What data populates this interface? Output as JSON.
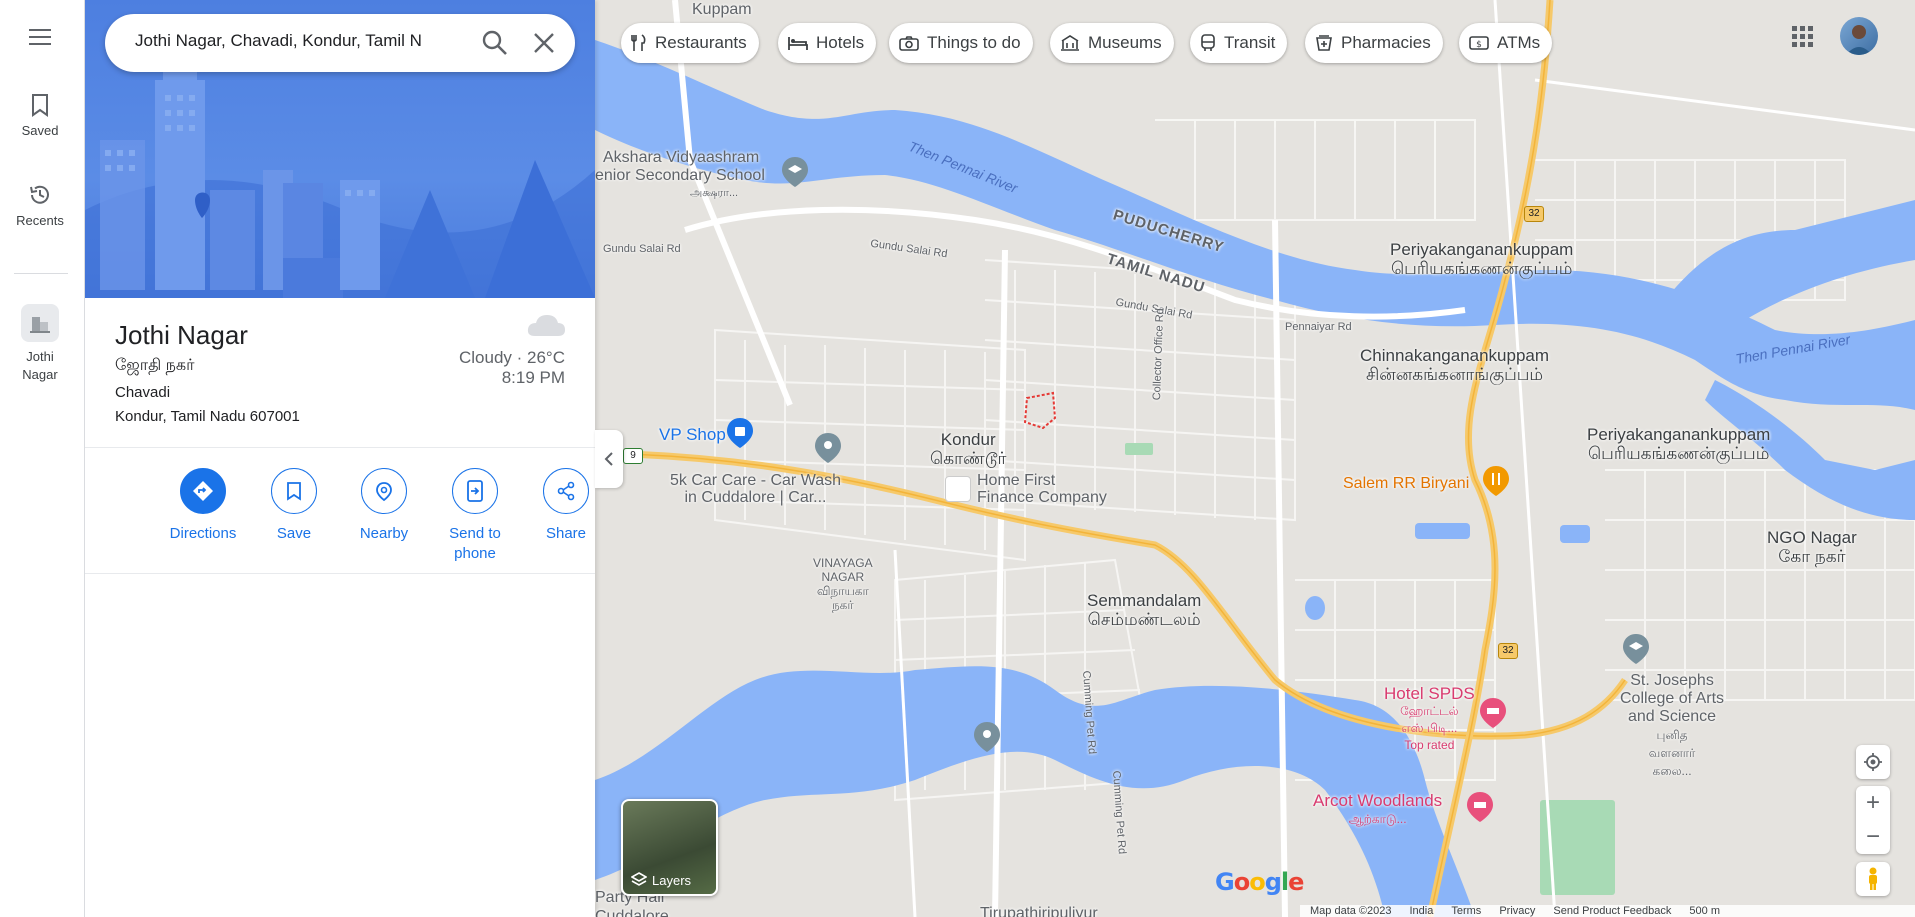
{
  "rail": {
    "menu_label": "",
    "saved_label": "Saved",
    "recents_label": "Recents",
    "place_label": "Jothi Nagar"
  },
  "search": {
    "value": "Jothi Nagar, Chavadi, Kondur, Tamil N"
  },
  "place": {
    "title": "Jothi Nagar",
    "local_name": "ஜோதி நகர்",
    "address_line1": "Chavadi",
    "address_line2": "Kondur, Tamil Nadu 607001",
    "weather": "Cloudy · 26°C",
    "time": "8:19 PM"
  },
  "actions": {
    "directions": "Directions",
    "save": "Save",
    "nearby": "Nearby",
    "send_line1": "Send to",
    "send_line2": "phone",
    "share": "Share"
  },
  "chips": {
    "restaurants": "Restaurants",
    "hotels": "Hotels",
    "things_to_do": "Things to do",
    "museums": "Museums",
    "transit": "Transit",
    "pharmacies": "Pharmacies",
    "atms": "ATMs"
  },
  "map_labels": {
    "kuppam": "Kuppam",
    "akshara": "Akshara Vidyaashram",
    "akshara2": "enior Secondary School",
    "akshara_local": "அக்ஷரா...",
    "then_pennai_1": "Then Pennai River",
    "then_pennai_2": "Then Pennai River",
    "puducherry": "PUDUCHERRY",
    "tamil_nadu": "TAMIL NADU",
    "gundu_salai_1": "Gundu Salai Rd",
    "gundu_salai_2": "Gundu Salai Rd",
    "gundu_salai_3": "Gundu Salai Rd",
    "pennaiyar_rd": "Pennaiyar Rd",
    "periya1_en": "Periyakanganankuppam",
    "periya1_ta": "பெரியகங்கணன்குப்பம்",
    "chinna_en": "Chinnakanganankuppam",
    "chinna_ta": "சின்னகங்கனாங்குப்பம்",
    "periya2_en": "Periyakanganankuppam",
    "periya2_ta": "பெரியகங்கணன்குப்பம்",
    "vp_shop": "VP Shop",
    "kondur_en": "Kondur",
    "kondur_ta": "கொண்டூர்",
    "home_first_1": "Home First",
    "home_first_2": "Finance Company",
    "car_care_1": "5k Car Care - Car Wash",
    "car_care_2": "in Cuddalore | Car...",
    "collector_rd": "Collector Office Rd",
    "salem_rr": "Salem RR Biryani",
    "ngo_en": "NGO Nagar",
    "ngo_ta": "கோ நகர்",
    "vinayaga_1": "VINAYAGA",
    "vinayaga_2": "NAGAR",
    "vinayaga_3": "விநாயகா",
    "vinayaga_4": "நகர்",
    "semm_en": "Semmandalam",
    "semm_ta": "செம்மண்டலம்",
    "hotel_spds": "Hotel SPDS",
    "hotel_spds_ta": "ஹோட்டல்",
    "hotel_spds_ta2": "எஸ் பிடி...",
    "top_rated": "Top rated",
    "st_josephs_1": "St. Josephs",
    "st_josephs_2": "College of Arts",
    "st_josephs_3": "and Science",
    "st_josephs_4": "புனித",
    "st_josephs_5": "வளனார்",
    "st_josephs_6": "கலை...",
    "cumming_1": "Cumming Pet Rd",
    "cumming_2": "Cumming Pet Rd",
    "arcot": "Arcot Woodlands",
    "arcot_ta": "ஆற்காடு...",
    "party_hall": "Party Hall",
    "cuddalore": "Cuddalore",
    "tirupathi": "Tirupathiripuliyur",
    "road_32a": "32",
    "road_32b": "32",
    "road_9": "9"
  },
  "layers_label": "Layers",
  "google": "Google",
  "footer": {
    "map_data": "Map data ©2023",
    "india": "India",
    "terms": "Terms",
    "privacy": "Privacy",
    "feedback": "Send Product Feedback",
    "scale": "500 m"
  },
  "colors": {
    "accent": "#1a73e8",
    "water": "#8ab4f8",
    "land": "#e5e3df",
    "highway": "#f6c96a",
    "pink_poi": "#e8507c",
    "orange_poi": "#f29900"
  }
}
